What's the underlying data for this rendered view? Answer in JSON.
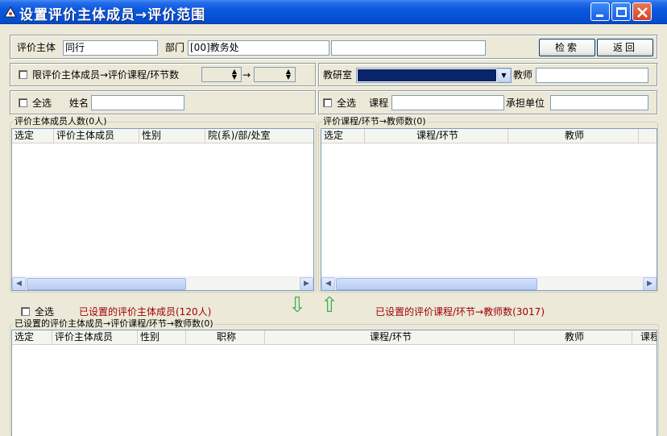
{
  "window": {
    "title": "设置评价主体成员→评价范围",
    "icon": "app-icon"
  },
  "search_row": {
    "subject_label": "评价主体",
    "subject_value": "同行",
    "dept_label": "部门",
    "dept_value": "[00]教务处",
    "extra_value": "",
    "search_button": "检索",
    "back_button": "返回"
  },
  "limit_row": {
    "limit_checkbox_label": "限评价主体成员→评价课程/环节数",
    "spin_from": "",
    "spin_to": "",
    "arrow_glyph": "→",
    "research_label": "教研室",
    "research_value": "",
    "teacher_label": "教师",
    "teacher_value": ""
  },
  "filter_left": {
    "select_all_label": "全选",
    "name_label": "姓名",
    "name_value": ""
  },
  "filter_right": {
    "select_all_label": "全选",
    "course_label": "课程",
    "course_value": "",
    "unit_label": "承担单位",
    "unit_value": ""
  },
  "left_list": {
    "legend": "评价主体成员人数(0人)",
    "columns": [
      "选定",
      "评价主体成员",
      "性别",
      "院(系)/部/处室"
    ]
  },
  "right_list": {
    "legend": "评价课程/环节→教师数(0)",
    "columns": [
      "选定",
      "课程/环节",
      "教师",
      ""
    ]
  },
  "middle": {
    "select_all_label": "全选",
    "set_members": "已设置的评价主体成员(120人)",
    "set_courses": "已设置的评价课程/环节→教师数(3017)",
    "down_arrow": "⇩",
    "up_arrow": "⇧"
  },
  "bottom_list": {
    "legend": "已设置的评价主体成员→评价课程/环节→教师数(0)",
    "columns": [
      "选定",
      "评价主体成员",
      "性别",
      "职称",
      "课程/环节",
      "教师",
      "课程"
    ]
  },
  "colors": {
    "title_bar": "#0653d6",
    "red_text": "#a00000",
    "arrow_green": "#3fae5a",
    "highlight": "#0a246a"
  }
}
